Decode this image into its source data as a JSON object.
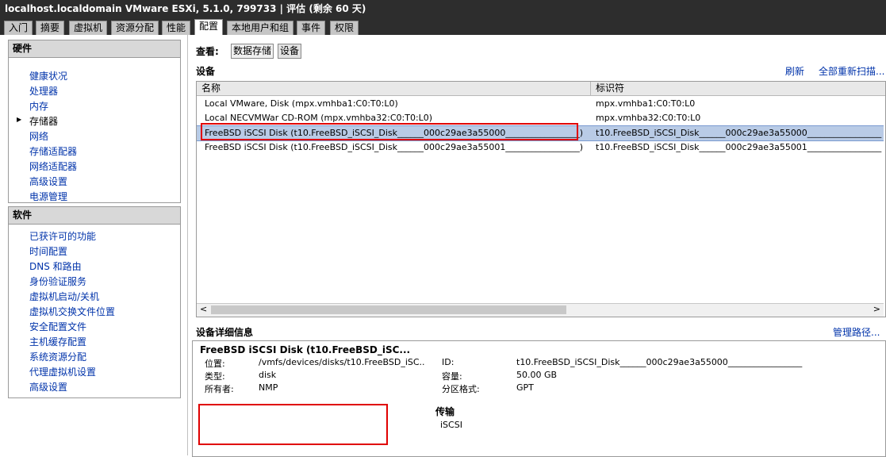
{
  "window": {
    "title": "localhost.localdomain VMware ESXi, 5.1.0, 799733 | 评估 (剩余 60 天)"
  },
  "tabs": [
    "入门",
    "摘要",
    "虚拟机",
    "资源分配",
    "性能",
    "配置",
    "本地用户和组",
    "事件",
    "权限"
  ],
  "hardware": {
    "header": "硬件",
    "items": [
      "健康状况",
      "处理器",
      "内存",
      "存储器",
      "网络",
      "存储适配器",
      "网络适配器",
      "高级设置",
      "电源管理"
    ]
  },
  "software": {
    "header": "软件",
    "items": [
      "已获许可的功能",
      "时间配置",
      "DNS 和路由",
      "身份验证服务",
      "虚拟机启动/关机",
      "虚拟机交换文件位置",
      "安全配置文件",
      "主机缓存配置",
      "系统资源分配",
      "代理虚拟机设置",
      "高级设置"
    ]
  },
  "view": {
    "label": "查看:",
    "datastores": "数据存储",
    "devices": "设备"
  },
  "devices": {
    "title": "设备",
    "refresh": "刷新",
    "rescan": "全部重新扫描...",
    "columns": [
      "名称",
      "标识符"
    ],
    "rows": [
      {
        "name": "Local VMware, Disk (mpx.vmhba1:C0:T0:L0)",
        "id": "mpx.vmhba1:C0:T0:L0"
      },
      {
        "name": "Local NECVMWar CD-ROM (mpx.vmhba32:C0:T0:L0)",
        "id": "mpx.vmhba32:C0:T0:L0"
      },
      {
        "name": "FreeBSD iSCSI Disk (t10.FreeBSD_iSCSI_Disk______000c29ae3a55000_________________)",
        "id": "t10.FreeBSD_iSCSI_Disk______000c29ae3a55000_________________"
      },
      {
        "name": "FreeBSD iSCSI Disk (t10.FreeBSD_iSCSI_Disk______000c29ae3a55001_________________)",
        "id": "t10.FreeBSD_iSCSI_Disk______000c29ae3a55001_________________"
      }
    ]
  },
  "details": {
    "title": "设备详细信息",
    "manage_paths": "管理路径...",
    "device_name": "FreeBSD iSCSI Disk (t10.FreeBSD_iSC...",
    "location_label": "位置:",
    "location": "/vmfs/devices/disks/t10.FreeBSD_iSC..",
    "type_label": "类型:",
    "type": "disk",
    "owner_label": "所有者:",
    "owner": "NMP",
    "id_label": "ID:",
    "id": "t10.FreeBSD_iSCSI_Disk______000c29ae3a55000_________________",
    "capacity_label": "容量:",
    "capacity": "50.00 GB",
    "partition_label": "分区格式:",
    "partition": "GPT",
    "transport_label": "传输",
    "transport": "iSCSI"
  },
  "accent": "#e00000"
}
